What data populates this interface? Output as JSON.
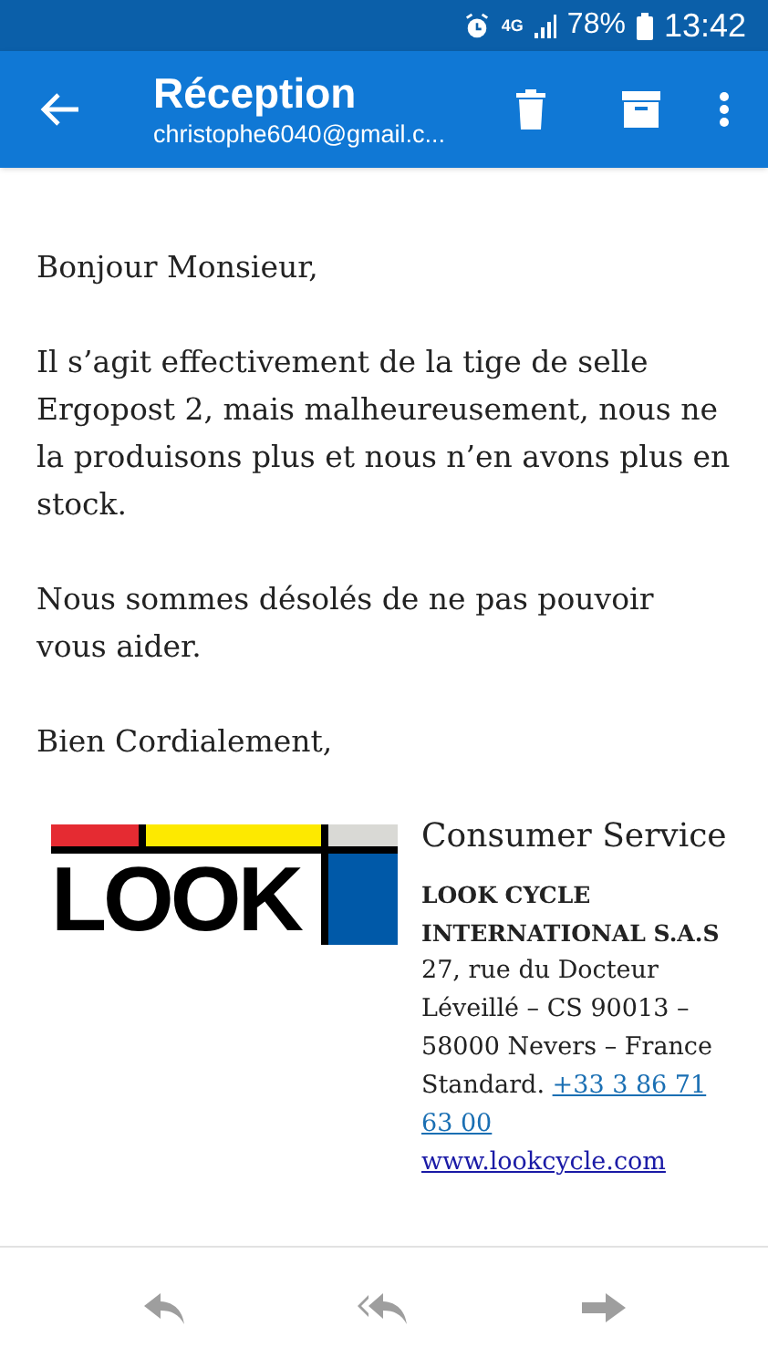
{
  "status_bar": {
    "network": "4G",
    "battery": "78%",
    "time": "13:42"
  },
  "header": {
    "title": "Réception",
    "account": "christophe6040@gmail.c..."
  },
  "body": {
    "paragraphs": [
      "Bonjour Monsieur,",
      "Il s’agit effectivement de la tige de selle Ergopost 2, mais malheureusement, nous ne la produisons plus et nous n’en avons plus en stock.",
      "Nous sommes désolés de ne pas pouvoir vous aider.",
      "Bien Cordialement,"
    ]
  },
  "signature": {
    "logo_text": "LOOK",
    "department": "Consumer Service",
    "company": "LOOK CYCLE INTERNATIONAL S.A.S",
    "address": "27, rue du Docteur Léveillé – CS 90013 – 58000 Nevers – France",
    "phone_label": "Standard.",
    "phone": "+33 3 86 71 63 00",
    "website": "www.lookcycle.com"
  }
}
